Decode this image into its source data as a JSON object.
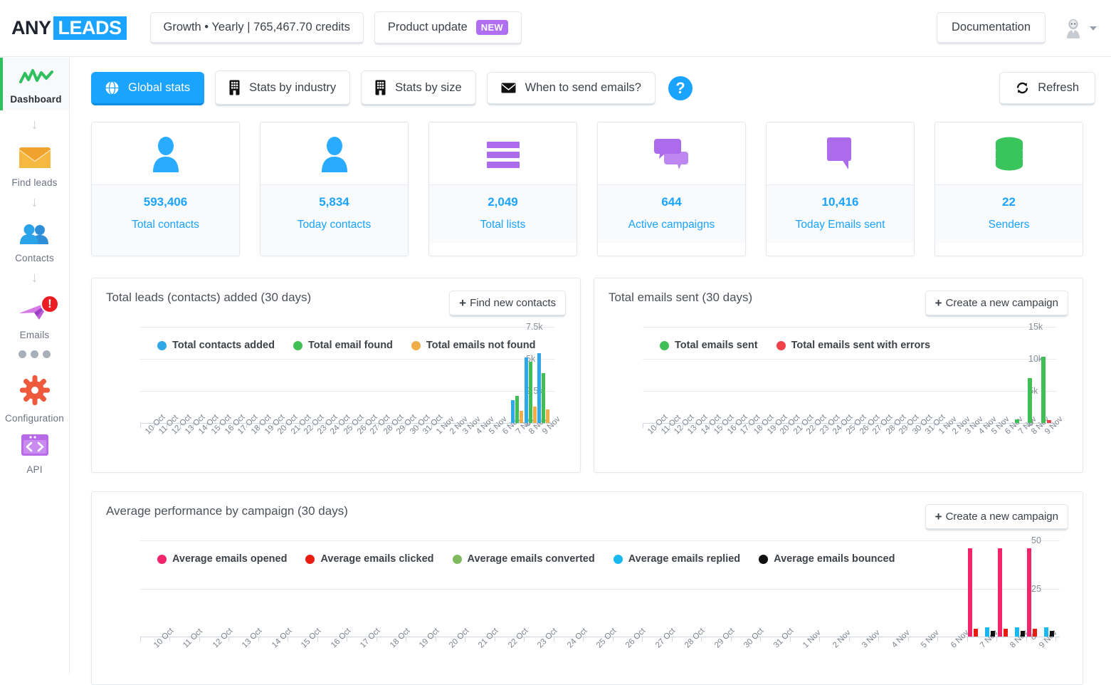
{
  "header": {
    "logo_any": "ANY",
    "logo_leads": "LEADS",
    "plan_button": "Growth • Yearly | 765,467.70 credits",
    "product_update": "Product update",
    "product_update_badge": "NEW",
    "documentation": "Documentation",
    "avatar_icon": "user-avatar-icon",
    "caret_icon": "chevron-down-icon"
  },
  "sidebar": {
    "items": [
      {
        "label": "Dashboard",
        "icon": "chart-line-icon",
        "active": true
      },
      {
        "label": "Find leads",
        "icon": "envelope-icon",
        "active": false
      },
      {
        "label": "Contacts",
        "icon": "users-icon",
        "active": false
      },
      {
        "label": "Emails",
        "icon": "paper-plane-icon",
        "active": false,
        "badge": "!"
      },
      {
        "label": "Configuration",
        "icon": "gear-icon",
        "active": false
      },
      {
        "label": "API",
        "icon": "code-window-icon",
        "active": false
      }
    ],
    "arrow": "↓",
    "dots_icon": "more-dots-icon"
  },
  "tabs": [
    {
      "label": "Global stats",
      "icon": "globe-icon",
      "active": true
    },
    {
      "label": "Stats by industry",
      "icon": "building-icon",
      "active": false
    },
    {
      "label": "Stats by size",
      "icon": "building-icon",
      "active": false
    },
    {
      "label": "When to send emails?",
      "icon": "envelope-icon",
      "active": false
    }
  ],
  "help_label": "?",
  "refresh": {
    "label": "Refresh",
    "icon": "refresh-icon"
  },
  "cards": [
    {
      "value": "593,406",
      "label": "Total contacts",
      "icon": "person-icon",
      "color": "#29ABFF",
      "tall": true
    },
    {
      "value": "5,834",
      "label": "Today contacts",
      "icon": "person-icon",
      "color": "#29ABFF",
      "tall": true
    },
    {
      "value": "2,049",
      "label": "Total lists",
      "icon": "list-icon",
      "color": "#AC6BEA",
      "tall": false
    },
    {
      "value": "644",
      "label": "Active campaigns",
      "icon": "chat-icon",
      "color": "#AC6BEA",
      "tall": false
    },
    {
      "value": "10,416",
      "label": "Today Emails sent",
      "icon": "speech-icon",
      "color": "#AC6BEA",
      "tall": false
    },
    {
      "value": "22",
      "label": "Senders",
      "icon": "database-icon",
      "color": "#39C55B",
      "tall": false
    }
  ],
  "panels": {
    "leads": {
      "title": "Total leads (contacts) added (30 days)",
      "button": "Find new contacts",
      "button_icon": "plus-icon"
    },
    "emails": {
      "title": "Total emails sent (30 days)",
      "button": "Create a new campaign",
      "button_icon": "plus-icon"
    },
    "perf": {
      "title": "Average performance by campaign (30 days)",
      "button": "Create a new campaign",
      "button_icon": "plus-icon"
    }
  },
  "chart_data": [
    {
      "id": "leads",
      "type": "bar",
      "title": "Total leads (contacts) added (30 days)",
      "xlabel": "",
      "ylabel": "",
      "ylim": [
        0,
        7500
      ],
      "yticks": [
        0,
        2500,
        5000,
        7500
      ],
      "ytick_labels": [
        "0",
        "2.5k",
        "5k",
        "7.5k"
      ],
      "grid": true,
      "legend_position": "top-left",
      "categories": [
        "10 Oct",
        "11 Oct",
        "12 Oct",
        "13 Oct",
        "14 Oct",
        "15 Oct",
        "16 Oct",
        "17 Oct",
        "18 Oct",
        "19 Oct",
        "20 Oct",
        "21 Oct",
        "22 Oct",
        "23 Oct",
        "24 Oct",
        "25 Oct",
        "26 Oct",
        "27 Oct",
        "28 Oct",
        "29 Oct",
        "30 Oct",
        "31 Oct",
        "1 Nov",
        "2 Nov",
        "3 Nov",
        "4 Nov",
        "5 Nov",
        "6 Nov",
        "7 Nov",
        "8 Nov",
        "9 Nov"
      ],
      "series": [
        {
          "name": "Total contacts added",
          "color": "#2EA8E8",
          "values": [
            0,
            0,
            0,
            0,
            0,
            0,
            0,
            0,
            0,
            0,
            0,
            0,
            0,
            0,
            0,
            0,
            0,
            0,
            0,
            0,
            0,
            0,
            0,
            0,
            0,
            0,
            0,
            0,
            1800,
            5100,
            5450
          ]
        },
        {
          "name": "Total email found",
          "color": "#3FBF55",
          "values": [
            0,
            0,
            0,
            0,
            0,
            0,
            0,
            0,
            0,
            0,
            0,
            0,
            0,
            0,
            0,
            0,
            0,
            0,
            0,
            0,
            0,
            0,
            0,
            0,
            0,
            0,
            0,
            0,
            2100,
            4800,
            3900
          ]
        },
        {
          "name": "Total emails not found",
          "color": "#EFAE47",
          "values": [
            0,
            0,
            0,
            0,
            0,
            0,
            0,
            0,
            0,
            0,
            0,
            0,
            0,
            0,
            0,
            0,
            0,
            0,
            0,
            0,
            0,
            0,
            0,
            0,
            0,
            0,
            0,
            0,
            950,
            1300,
            1050
          ]
        }
      ]
    },
    {
      "id": "emails",
      "type": "bar",
      "title": "Total emails sent (30 days)",
      "xlabel": "",
      "ylabel": "",
      "ylim": [
        0,
        15000
      ],
      "yticks": [
        0,
        5000,
        10000,
        15000
      ],
      "ytick_labels": [
        "0",
        "5k",
        "10k",
        "15k"
      ],
      "grid": true,
      "legend_position": "top-left",
      "categories": [
        "10 Oct",
        "11 Oct",
        "12 Oct",
        "13 Oct",
        "14 Oct",
        "15 Oct",
        "16 Oct",
        "17 Oct",
        "18 Oct",
        "19 Oct",
        "20 Oct",
        "21 Oct",
        "22 Oct",
        "23 Oct",
        "24 Oct",
        "25 Oct",
        "26 Oct",
        "27 Oct",
        "28 Oct",
        "29 Oct",
        "30 Oct",
        "31 Oct",
        "1 Nov",
        "2 Nov",
        "3 Nov",
        "4 Nov",
        "5 Nov",
        "6 Nov",
        "7 Nov",
        "8 Nov",
        "9 Nov"
      ],
      "series": [
        {
          "name": "Total emails sent",
          "color": "#3FBF55",
          "values": [
            0,
            0,
            0,
            0,
            0,
            0,
            0,
            0,
            0,
            0,
            0,
            0,
            0,
            0,
            0,
            0,
            0,
            0,
            0,
            0,
            0,
            0,
            0,
            0,
            0,
            0,
            0,
            0,
            600,
            7000,
            10300
          ]
        },
        {
          "name": "Total emails sent with errors",
          "color": "#F0424A",
          "values": [
            0,
            0,
            0,
            0,
            0,
            0,
            0,
            0,
            0,
            0,
            0,
            0,
            0,
            0,
            0,
            0,
            0,
            0,
            0,
            0,
            0,
            0,
            0,
            0,
            0,
            0,
            0,
            0,
            0,
            0,
            400
          ]
        }
      ]
    },
    {
      "id": "perf",
      "type": "bar",
      "title": "Average performance by campaign (30 days)",
      "xlabel": "",
      "ylabel": "",
      "ylim": [
        0,
        50
      ],
      "yticks": [
        0,
        25,
        50
      ],
      "ytick_labels": [
        "0",
        "25",
        "50"
      ],
      "grid": true,
      "legend_position": "top-left",
      "categories": [
        "10 Oct",
        "11 Oct",
        "12 Oct",
        "13 Oct",
        "14 Oct",
        "15 Oct",
        "16 Oct",
        "17 Oct",
        "18 Oct",
        "19 Oct",
        "20 Oct",
        "21 Oct",
        "22 Oct",
        "23 Oct",
        "24 Oct",
        "25 Oct",
        "26 Oct",
        "27 Oct",
        "28 Oct",
        "29 Oct",
        "30 Oct",
        "31 Oct",
        "1 Nov",
        "2 Nov",
        "3 Nov",
        "4 Nov",
        "5 Nov",
        "6 Nov",
        "7 Nov",
        "8 Nov",
        "9 Nov"
      ],
      "series": [
        {
          "name": "Average emails opened",
          "color": "#F2256A",
          "values": [
            0,
            0,
            0,
            0,
            0,
            0,
            0,
            0,
            0,
            0,
            0,
            0,
            0,
            0,
            0,
            0,
            0,
            0,
            0,
            0,
            0,
            0,
            0,
            0,
            0,
            0,
            0,
            0,
            46,
            46,
            46
          ]
        },
        {
          "name": "Average emails clicked",
          "color": "#E81C10",
          "values": [
            0,
            0,
            0,
            0,
            0,
            0,
            0,
            0,
            0,
            0,
            0,
            0,
            0,
            0,
            0,
            0,
            0,
            0,
            0,
            0,
            0,
            0,
            0,
            0,
            0,
            0,
            0,
            0,
            4,
            4,
            4
          ]
        },
        {
          "name": "Average emails converted",
          "color": "#7FBA5E",
          "values": [
            0,
            0,
            0,
            0,
            0,
            0,
            0,
            0,
            0,
            0,
            0,
            0,
            0,
            0,
            0,
            0,
            0,
            0,
            0,
            0,
            0,
            0,
            0,
            0,
            0,
            0,
            0,
            0,
            0,
            0,
            0
          ]
        },
        {
          "name": "Average emails replied",
          "color": "#19B9F0",
          "values": [
            0,
            0,
            0,
            0,
            0,
            0,
            0,
            0,
            0,
            0,
            0,
            0,
            0,
            0,
            0,
            0,
            0,
            0,
            0,
            0,
            0,
            0,
            0,
            0,
            0,
            0,
            0,
            0,
            5,
            5,
            5
          ]
        },
        {
          "name": "Average emails bounced",
          "color": "#111111",
          "values": [
            0,
            0,
            0,
            0,
            0,
            0,
            0,
            0,
            0,
            0,
            0,
            0,
            0,
            0,
            0,
            0,
            0,
            0,
            0,
            0,
            0,
            0,
            0,
            0,
            0,
            0,
            0,
            0,
            3,
            3,
            3
          ]
        }
      ]
    }
  ]
}
